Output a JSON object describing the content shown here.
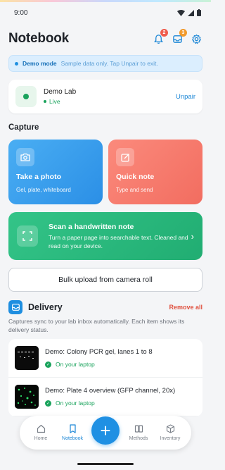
{
  "status_bar": {
    "time": "9:00"
  },
  "header": {
    "title": "Notebook",
    "notifications_count": "2",
    "inbox_count": "3"
  },
  "demo_banner": {
    "title": "Demo mode",
    "subtitle": "Sample data only. Tap Unpair to exit."
  },
  "lab": {
    "name": "Demo Lab",
    "status": "Live",
    "unpair_label": "Unpair"
  },
  "capture": {
    "section_title": "Capture",
    "photo": {
      "title": "Take a photo",
      "subtitle": "Gel, plate, whiteboard"
    },
    "note": {
      "title": "Quick note",
      "subtitle": "Type and send"
    },
    "scan": {
      "title": "Scan a handwritten note",
      "subtitle": "Turn a paper page into searchable text. Cleaned and read on your device."
    },
    "bulk_label": "Bulk upload from camera roll"
  },
  "delivery": {
    "title": "Delivery",
    "remove_all_label": "Remove all",
    "description": "Captures sync to your lab inbox automatically. Each item shows its delivery status.",
    "items": [
      {
        "title": "Demo: Colony PCR gel, lanes 1 to 8",
        "status": "On your laptop"
      },
      {
        "title": "Demo: Plate 4 overview (GFP channel, 20x)",
        "status": "On your laptop"
      }
    ]
  },
  "nav": {
    "home": "Home",
    "notebook": "Notebook",
    "methods": "Methods",
    "inventory": "Inventory"
  },
  "colors": {
    "accent": "#1f90e3",
    "live_green": "#1aa35c",
    "danger": "#e0513f"
  }
}
